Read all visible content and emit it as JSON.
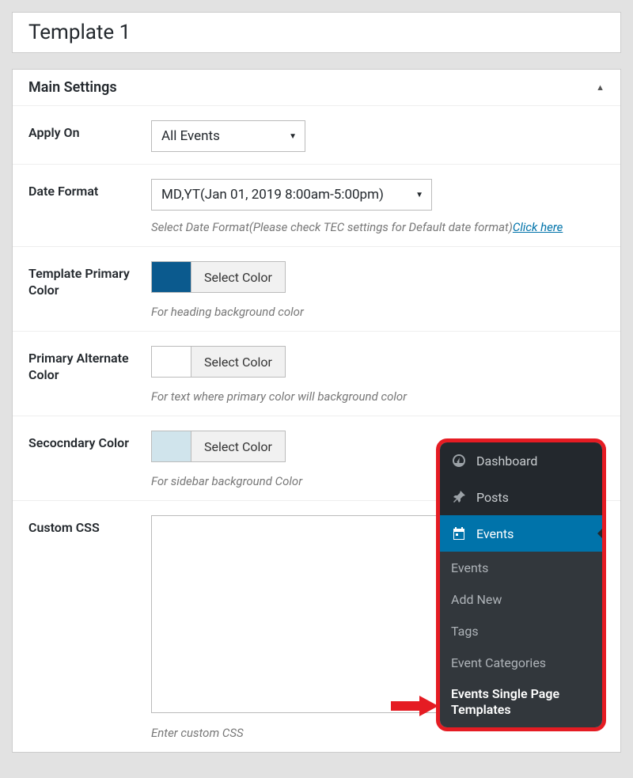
{
  "title": "Template 1",
  "panel_title": "Main Settings",
  "fields": {
    "apply_on": {
      "label": "Apply On",
      "value": "All Events"
    },
    "date_format": {
      "label": "Date Format",
      "value": "MD,YT(Jan 01, 2019 8:00am-5:00pm)",
      "hint_lead": "Select Date Format(Please check TEC settings for Default date format)",
      "hint_link": "Click here"
    },
    "primary_color": {
      "label": "Template Primary Color",
      "button": "Select Color",
      "swatch": "#0b5a8e",
      "hint": "For heading background color"
    },
    "alt_color": {
      "label": "Primary Alternate Color",
      "button": "Select Color",
      "swatch": "#ffffff",
      "hint": "For text where primary color will background color"
    },
    "secondary_color": {
      "label": "Secocndary Color",
      "button": "Select Color",
      "swatch": "#d0e4ec",
      "hint": "For sidebar background Color"
    },
    "custom_css": {
      "label": "Custom CSS",
      "value": "",
      "hint": "Enter custom CSS"
    }
  },
  "admin_menu": {
    "dashboard": "Dashboard",
    "posts": "Posts",
    "events": "Events",
    "sub_events": "Events",
    "sub_addnew": "Add New",
    "sub_tags": "Tags",
    "sub_cats": "Event Categories",
    "sub_templates": "Events Single Page Templates"
  }
}
